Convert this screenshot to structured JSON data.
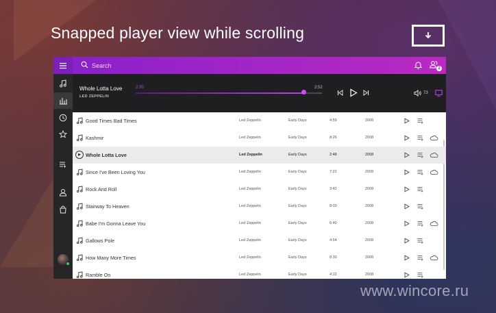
{
  "headline": "Snapped player view while scrolling",
  "watermark": "www.wincore.ru",
  "search": {
    "placeholder": "Search"
  },
  "topbar": {
    "users_badge": "2"
  },
  "now_playing": {
    "title": "Whole Lotta Love",
    "artist": "LED ZEPPELIN",
    "elapsed": "2:35",
    "total": "2:52",
    "progress": 0.9,
    "volume": "73"
  },
  "tracks": [
    {
      "title": "Good Times Bad Times",
      "artist": "Led Zeppelin",
      "album": "Early Days",
      "duration": "4:59",
      "year": "2008",
      "cloud": false,
      "active": false
    },
    {
      "title": "Kashmir",
      "artist": "Led Zeppelin",
      "album": "Early Days",
      "duration": "8:26",
      "year": "2008",
      "cloud": true,
      "active": false
    },
    {
      "title": "Whole Lotta Love",
      "artist": "Led Zeppelin",
      "album": "Early Days",
      "duration": "2:48",
      "year": "2008",
      "cloud": true,
      "active": true
    },
    {
      "title": "Since I've Been Loving You",
      "artist": "Led Zeppelin",
      "album": "Early Days",
      "duration": "7:22",
      "year": "2008",
      "cloud": true,
      "active": false
    },
    {
      "title": "Rock And Roll",
      "artist": "Led Zeppelin",
      "album": "Early Days",
      "duration": "3:42",
      "year": "2008",
      "cloud": false,
      "active": false
    },
    {
      "title": "Stairway To Heaven",
      "artist": "Led Zeppelin",
      "album": "Early Days",
      "duration": "8:03",
      "year": "2008",
      "cloud": false,
      "active": false
    },
    {
      "title": "Babe I'm Gonna Leave You",
      "artist": "Led Zeppelin",
      "album": "Early Days",
      "duration": "6:40",
      "year": "2008",
      "cloud": true,
      "active": false
    },
    {
      "title": "Gallows Pole",
      "artist": "Led Zeppelin",
      "album": "Early Days",
      "duration": "4:54",
      "year": "2008",
      "cloud": false,
      "active": false
    },
    {
      "title": "How Many More Times",
      "artist": "Led Zeppelin",
      "album": "Early Days",
      "duration": "8:30",
      "year": "2008",
      "cloud": true,
      "active": false
    },
    {
      "title": "Ramble On",
      "artist": "Led Zeppelin",
      "album": "Early Days",
      "duration": "4:22",
      "year": "2008",
      "cloud": false,
      "active": false
    }
  ],
  "icons": {
    "menu": "hamburger-icon",
    "music": "music-note-icon",
    "equalizer": "equalizer-icon",
    "recent": "clock-icon",
    "favorites": "star-icon",
    "queue": "queue-icon",
    "profile": "user-icon",
    "store": "shopping-bag-icon",
    "search": "search-icon",
    "notifications": "bell-icon",
    "friends": "users-icon"
  },
  "colors": {
    "accent": "#a626c7",
    "accent_dark": "#7b1fb8",
    "player_bg": "#1f1f21",
    "sidebar_bg": "#262628",
    "online": "#39d353"
  }
}
